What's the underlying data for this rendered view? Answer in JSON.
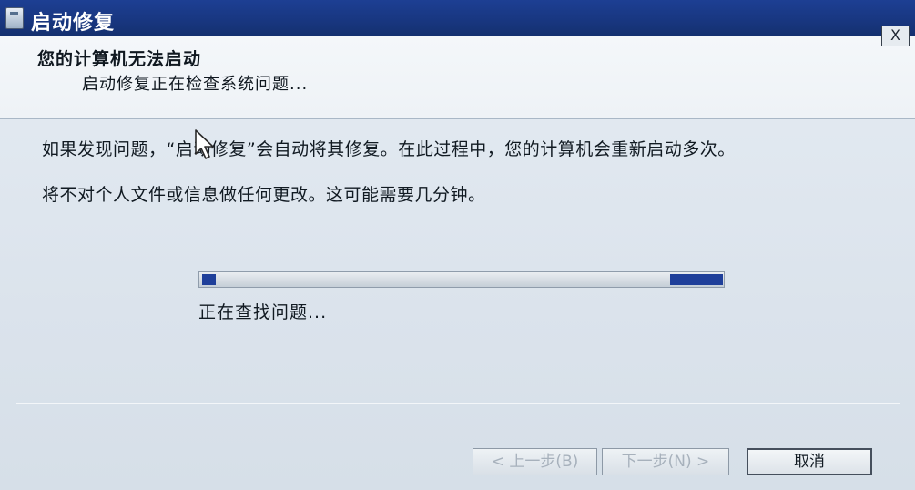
{
  "window": {
    "title": "启动修复",
    "close_label": "X"
  },
  "header": {
    "heading": "您的计算机无法启动",
    "subheading": "启动修复正在检查系统问题..."
  },
  "content": {
    "paragraph1": "如果发现问题，“启动修复”会自动将其修复。在此过程中，您的计算机会重新启动多次。",
    "paragraph2": "将不对个人文件或信息做任何更改。这可能需要几分钟。",
    "status": "正在查找问题..."
  },
  "progress": {
    "mode": "indeterminate",
    "color": "#1f3f9a"
  },
  "buttons": {
    "back": "< 上一步(B)",
    "next": "下一步(N) >",
    "cancel": "取消"
  },
  "colors": {
    "titlebar": "#1d3f93",
    "panel": "#e4ebf2",
    "text": "#111a22",
    "disabled_text": "#a7b1bc"
  }
}
